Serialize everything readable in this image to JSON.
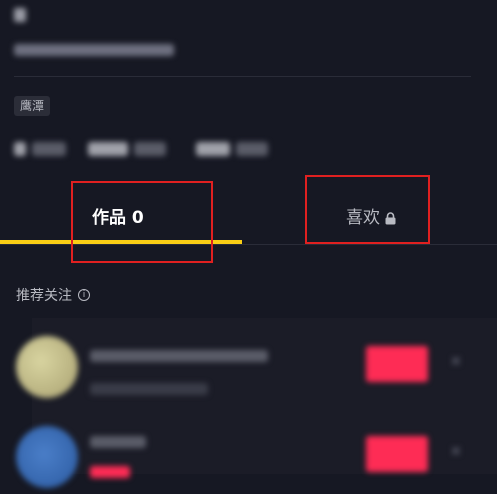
{
  "profile": {
    "location_tag": "鹰潭"
  },
  "tabs": [
    {
      "label": "作品 0",
      "active": true
    },
    {
      "label": "喜欢",
      "active": false,
      "icon": "lock-icon"
    }
  ],
  "recommend": {
    "title": "推荐关注",
    "icon": "info-icon"
  },
  "colors": {
    "background": "#161823",
    "accent_underline": "#face15",
    "follow_button": "#fe2c55",
    "highlight_box": "#e02020"
  }
}
